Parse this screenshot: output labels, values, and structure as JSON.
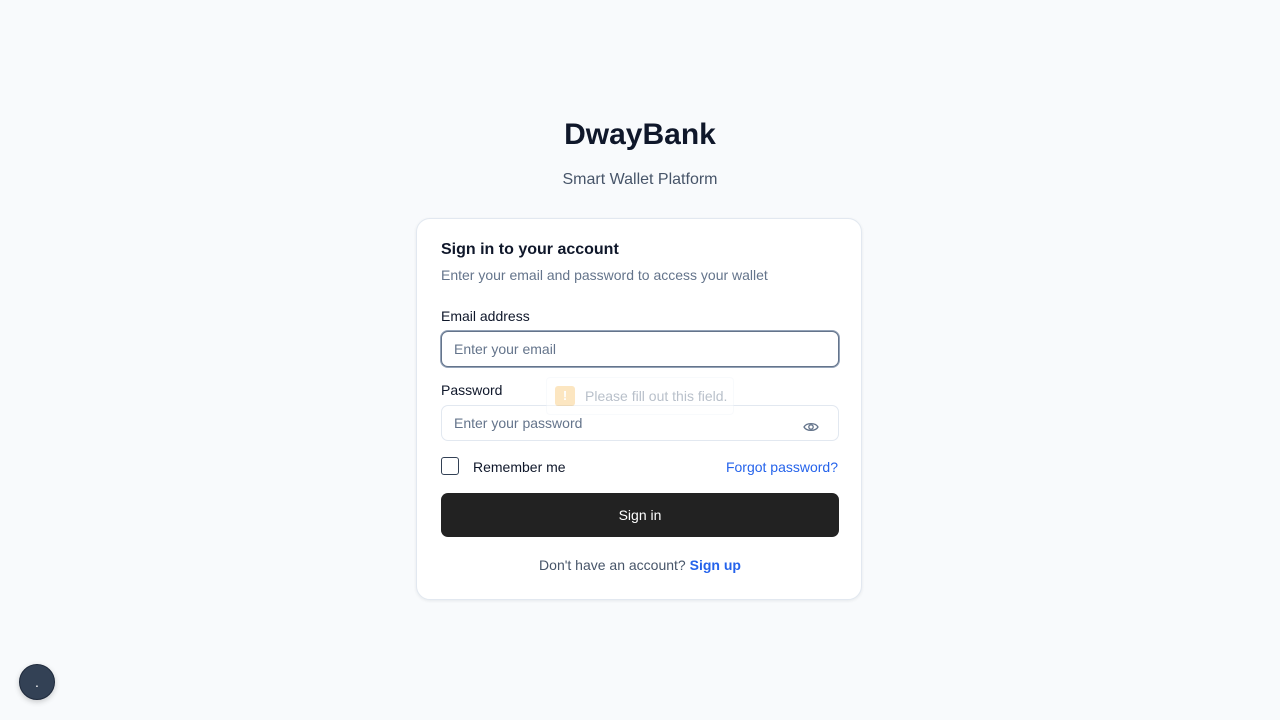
{
  "brand": {
    "title": "DwayBank",
    "subtitle": "Smart Wallet Platform"
  },
  "card": {
    "title": "Sign in to your account",
    "description": "Enter your email and password to access your wallet",
    "email": {
      "label": "Email address",
      "placeholder": "Enter your email",
      "value": ""
    },
    "password": {
      "label": "Password",
      "placeholder": "Enter your password",
      "value": "",
      "toggle_icon": "eye-icon"
    },
    "validation_tooltip": {
      "icon": "warning-icon",
      "text": "Please fill out this field."
    },
    "remember_me_label": "Remember me",
    "remember_me_checked": false,
    "forgot_password_label": "Forgot password?",
    "sign_in_label": "Sign in",
    "footer": {
      "prompt": "Don't have an account?",
      "signup_label": "Sign up"
    }
  },
  "floating_button": {
    "icon": "dot-icon",
    "label": "."
  },
  "colors": {
    "background": "#f8fafc",
    "primary_button": "#222222",
    "link": "#2563eb",
    "warning": "#f59e0b"
  }
}
